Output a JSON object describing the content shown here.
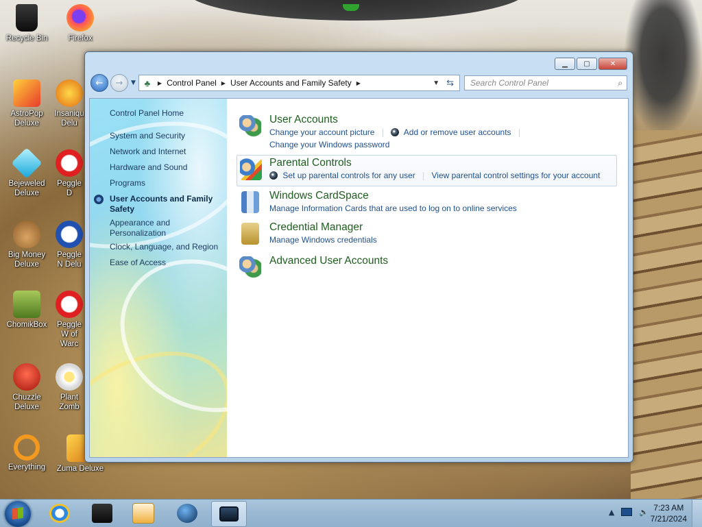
{
  "desktop": {
    "icons": [
      {
        "label": "Recycle Bin",
        "icon": "recycle-bin-icon",
        "color": "#1b1b1b"
      },
      {
        "label": "Firefox",
        "icon": "firefox-icon",
        "color": "#ff7139"
      },
      {
        "label": "AstroPop Deluxe",
        "icon": "astropop-icon",
        "color": "#e83a2b"
      },
      {
        "label": "Insaniquarium Deluxe",
        "icon": "insaniquarium-icon",
        "color": "#f0a020"
      },
      {
        "label": "Bejeweled Deluxe",
        "icon": "bejeweled-icon",
        "color": "#2cc6f0"
      },
      {
        "label": "Peggle Deluxe",
        "icon": "peggle-icon",
        "color": "#e02020"
      },
      {
        "label": "Big Money Deluxe",
        "icon": "big-money-icon",
        "color": "#a9773c"
      },
      {
        "label": "Peggle Nights",
        "icon": "peggle-nights-icon",
        "color": "#e02020"
      },
      {
        "label": "ChomikBox",
        "icon": "chomikbox-icon",
        "color": "#7aa23c"
      },
      {
        "label": "Peggle World of Warcraft",
        "icon": "peggle-wow-icon",
        "color": "#e02020"
      },
      {
        "label": "Chuzzle Deluxe",
        "icon": "chuzzle-icon",
        "color": "#d42a1a"
      },
      {
        "label": "Plants vs. Zombies",
        "icon": "pvz-icon",
        "color": "#f4f4f4"
      },
      {
        "label": "Everything",
        "icon": "everything-icon",
        "color": "#f29a1f"
      },
      {
        "label": "Zuma Deluxe",
        "icon": "zuma-icon",
        "color": "#f1a11a"
      }
    ],
    "labels_visible": {
      "recycle": "Recycle Bin",
      "firefox": "Firefox",
      "astropop": "AstroPop Deluxe",
      "insaniquarium": "Insaniqu Delu",
      "bejeweled": "Bejeweled Deluxe",
      "peggle1": "Peggle D",
      "bigmoney": "Big Money Deluxe",
      "peggle2": "Peggle N Delu",
      "chomikbox": "ChomikBox",
      "peggle3": "Peggle W of Warc",
      "chuzzle": "Chuzzle Deluxe",
      "plants": "Plant Zomb",
      "everything": "Everything",
      "zuma": "Zuma Deluxe"
    }
  },
  "window": {
    "address": {
      "segments": [
        "Control Panel",
        "User Accounts and Family Safety"
      ]
    },
    "search_placeholder": "Search Control Panel",
    "left_pane": {
      "home": "Control Panel Home",
      "items": [
        "System and Security",
        "Network and Internet",
        "Hardware and Sound",
        "Programs",
        "User Accounts and Family Safety",
        "Appearance and Personalization",
        "Clock, Language, and Region",
        "Ease of Access"
      ],
      "active_index": 4
    },
    "categories": [
      {
        "title": "User Accounts",
        "icon": "user-accounts-icon",
        "links": [
          "Change your account picture",
          "Add or remove user accounts",
          "Change your Windows password"
        ]
      },
      {
        "title": "Parental Controls",
        "icon": "parental-controls-icon",
        "links": [
          "Set up parental controls for any user",
          "View parental control settings for your account"
        ]
      },
      {
        "title": "Windows CardSpace",
        "icon": "cardspace-icon",
        "links": [
          "Manage Information Cards that are used to log on to online services"
        ]
      },
      {
        "title": "Credential Manager",
        "icon": "credential-manager-icon",
        "links": [
          "Manage Windows credentials"
        ]
      },
      {
        "title": "Advanced User Accounts",
        "icon": "advanced-user-accounts-icon",
        "links": []
      }
    ]
  },
  "taskbar": {
    "clock_time": "7:23 AM",
    "clock_date": "7/21/2024",
    "pinned": [
      "internet-explorer-icon",
      "dark-app-icon",
      "media-player-icon",
      "globe-app-icon",
      "control-panel-window-icon"
    ]
  },
  "colors": {
    "link": "#1e4f8e",
    "category_title": "#1e5e1e"
  }
}
